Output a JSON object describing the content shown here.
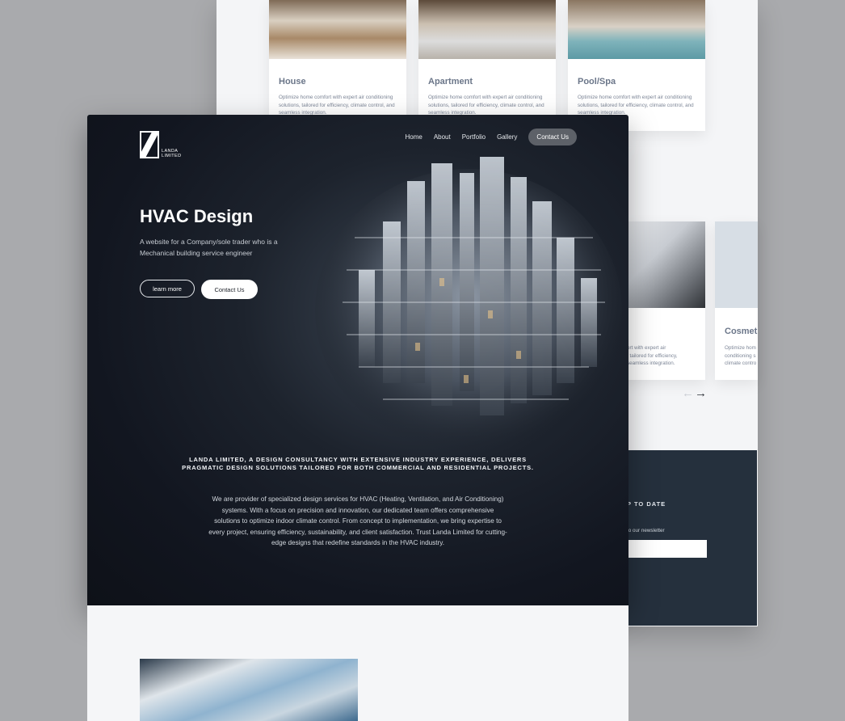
{
  "back_page": {
    "cards": [
      {
        "title": "House",
        "desc": "Optimize home comfort with expert air conditioning solutions, tailored for efficiency, climate control, and seamless integration."
      },
      {
        "title": "Apartment",
        "desc": "Optimize home comfort with expert air conditioning solutions, tailored for efficiency, climate control, and seamless integration."
      },
      {
        "title": "Pool/Spa",
        "desc": "Optimize home comfort with expert air conditioning solutions, tailored for efficiency, climate control, and seamless integration."
      }
    ],
    "card_office_desc": "ort with expert air\n, tailored for efficiency,\nseamless integration.",
    "card_cosmetic_title": "Cosmeti",
    "card_cosmetic_desc": "Optimize hom\nconditioning s\nclimate contro",
    "newsletter": {
      "heading": "P TO DATE",
      "subtext": "to our newsletter"
    }
  },
  "hero": {
    "logo_text": "LANDA\nLIMITED",
    "nav": [
      "Home",
      "About",
      "Portfolio",
      "Gallery"
    ],
    "nav_cta": "Contact Us",
    "title": "HVAC Design",
    "lede": "A website for a Company/sole trader who is a Mechanical building service engineer",
    "learn_more": "learn more",
    "contact": "Contact Us",
    "tagline": "LANDA LIMITED, A DESIGN CONSULTANCY WITH EXTENSIVE INDUSTRY EXPERIENCE, DELIVERS PRAGMATIC DESIGN SOLUTIONS TAILORED FOR BOTH COMMERCIAL AND RESIDENTIAL PROJECTS.",
    "about": "We are provider of specialized design services for HVAC (Heating, Ventilation, and Air Conditioning) systems. With a focus on precision and innovation, our dedicated team offers comprehensive solutions to optimize indoor climate control. From concept to implementation, we bring expertise to every project, ensuring efficiency, sustainability, and client satisfaction. Trust Landa Limited for cutting-edge designs that redefine standards in the HVAC industry."
  },
  "icons": {
    "prev": "arrow-left-icon",
    "next": "arrow-right-icon"
  }
}
